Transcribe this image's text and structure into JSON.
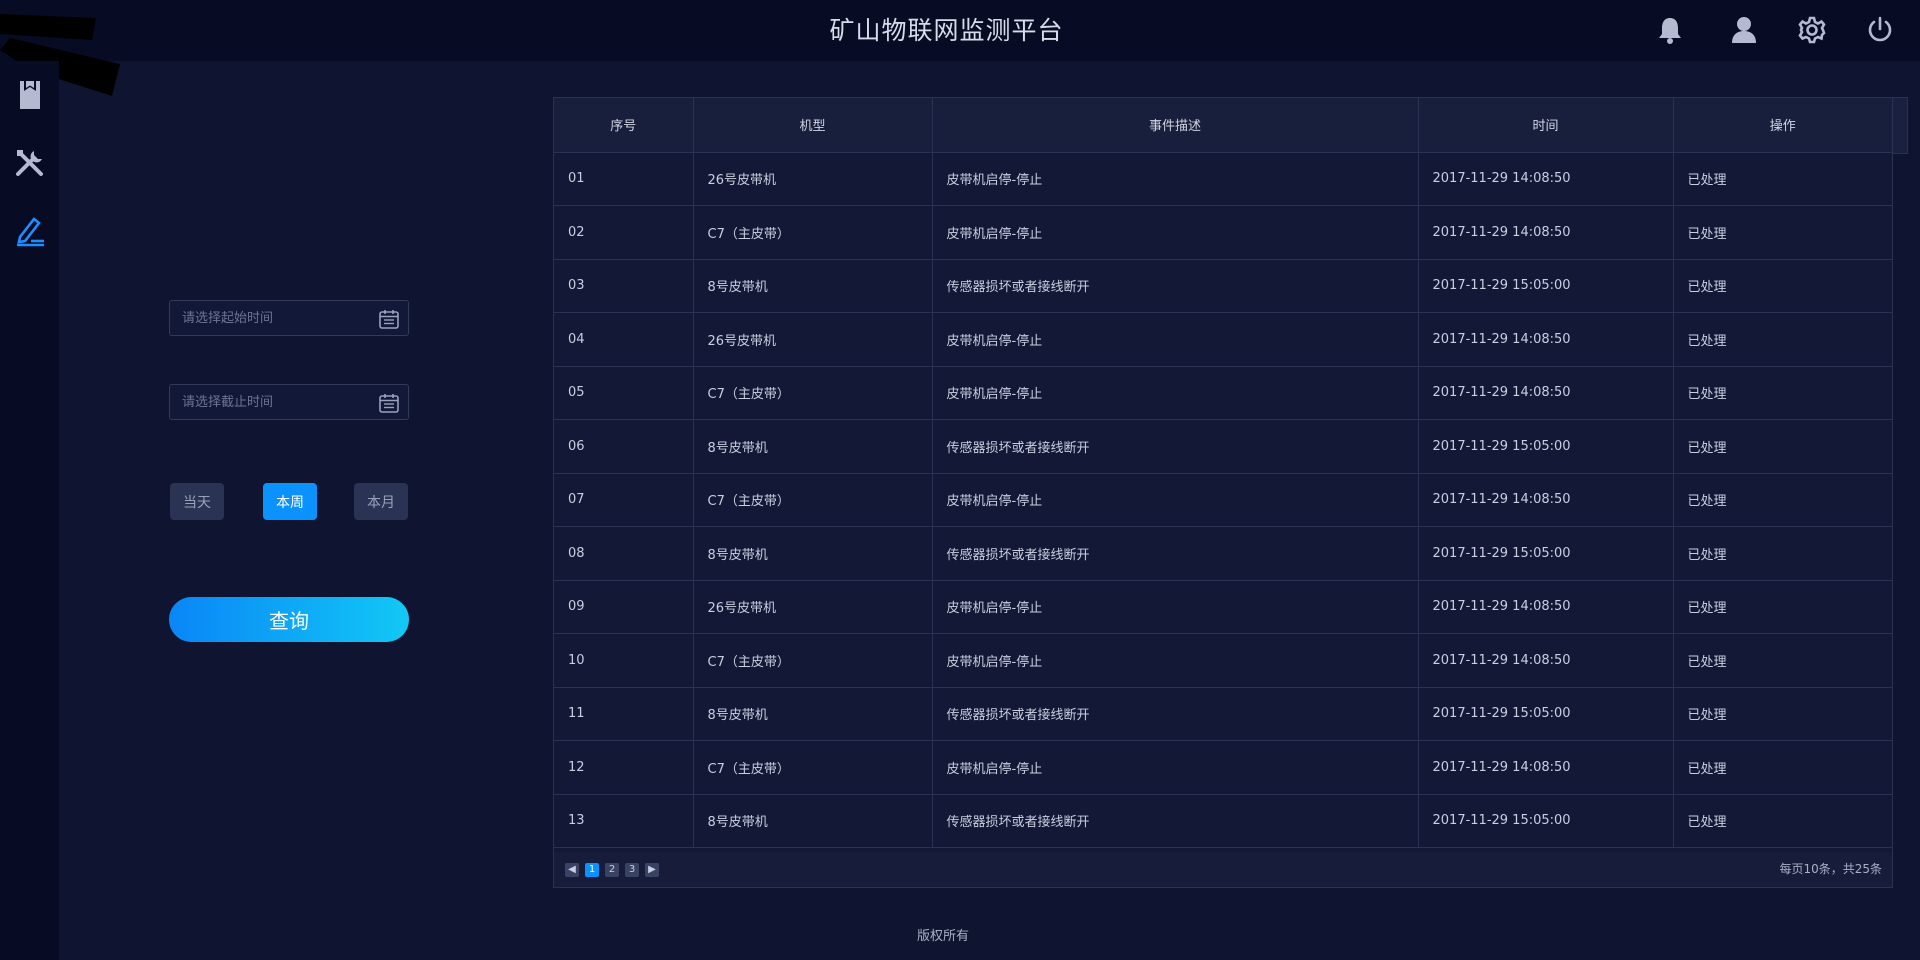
{
  "header": {
    "title": "矿山物联网监测平台",
    "icons": [
      "bell-icon",
      "user-icon",
      "gear-icon",
      "power-icon"
    ]
  },
  "sidebar": {
    "items": [
      {
        "icon": "document-icon",
        "active": false
      },
      {
        "icon": "tools-icon",
        "active": false
      },
      {
        "icon": "edit-icon",
        "active": true
      }
    ]
  },
  "filter": {
    "start_placeholder": "请选择起始时间",
    "end_placeholder": "请选择截止时间",
    "quick": {
      "today": "当天",
      "week": "本周",
      "month": "本月"
    },
    "selected_quick": "本周",
    "query_label": "查询"
  },
  "table": {
    "columns": [
      "序号",
      "机型",
      "事件描述",
      "时间",
      "操作"
    ],
    "rows": [
      [
        "01",
        "26号皮带机",
        "皮带机启停-停止",
        "2017-11-29 14:08:50",
        "已处理"
      ],
      [
        "02",
        "C7（主皮带）",
        "皮带机启停-停止",
        "2017-11-29 14:08:50",
        "已处理"
      ],
      [
        "03",
        "8号皮带机",
        "传感器损坏或者接线断开",
        "2017-11-29 15:05:00",
        "已处理"
      ],
      [
        "04",
        "26号皮带机",
        "皮带机启停-停止",
        "2017-11-29 14:08:50",
        "已处理"
      ],
      [
        "05",
        "C7（主皮带）",
        "皮带机启停-停止",
        "2017-11-29 14:08:50",
        "已处理"
      ],
      [
        "06",
        "8号皮带机",
        "传感器损坏或者接线断开",
        "2017-11-29 15:05:00",
        "已处理"
      ],
      [
        "07",
        "C7（主皮带）",
        "皮带机启停-停止",
        "2017-11-29 14:08:50",
        "已处理"
      ],
      [
        "08",
        "8号皮带机",
        "传感器损坏或者接线断开",
        "2017-11-29 15:05:00",
        "已处理"
      ],
      [
        "09",
        "26号皮带机",
        "皮带机启停-停止",
        "2017-11-29 14:08:50",
        "已处理"
      ],
      [
        "10",
        "C7（主皮带）",
        "皮带机启停-停止",
        "2017-11-29 14:08:50",
        "已处理"
      ],
      [
        "11",
        "8号皮带机",
        "传感器损坏或者接线断开",
        "2017-11-29 15:05:00",
        "已处理"
      ],
      [
        "12",
        "C7（主皮带）",
        "皮带机启停-停止",
        "2017-11-29 14:08:50",
        "已处理"
      ],
      [
        "13",
        "8号皮带机",
        "传感器损坏或者接线断开",
        "2017-11-29 15:05:00",
        "已处理"
      ]
    ]
  },
  "pagination": {
    "pages": [
      "1",
      "2",
      "3"
    ],
    "current": "1",
    "info": "每页10条，共25条"
  },
  "footer": {
    "text": "版权所有"
  },
  "colors": {
    "accent": "#0b92ff",
    "header_bg": "#070b24",
    "page_bg": "#0f1530"
  }
}
